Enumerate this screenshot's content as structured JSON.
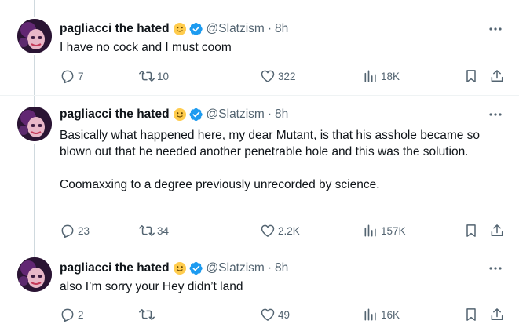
{
  "tweets": [
    {
      "name": "pagliacci the hated",
      "handle": "@Slatzism",
      "separator": "·",
      "time": "8h",
      "text": "I have no cock and I must coom",
      "replies": "7",
      "reposts": "10",
      "likes": "322",
      "views": "18K"
    },
    {
      "name": "pagliacci the hated",
      "handle": "@Slatzism",
      "separator": "·",
      "time": "8h",
      "text": "Basically what happened here, my dear Mutant, is that his asshole became so blown out that he needed another penetrable hole and this was the solution.\n\nCoomaxxing to a degree previously unrecorded by science.",
      "replies": "23",
      "reposts": "34",
      "likes": "2.2K",
      "views": "157K"
    },
    {
      "name": "pagliacci the hated",
      "handle": "@Slatzism",
      "separator": "·",
      "time": "8h",
      "text": "also I’m sorry your Hey didn’t land",
      "replies": "2",
      "reposts": "",
      "likes": "49",
      "views": "16K"
    }
  ],
  "colors": {
    "text": "#0f1419",
    "secondary": "#536471",
    "verified": "#1d9bf0",
    "thread_line": "#cfd9de"
  }
}
